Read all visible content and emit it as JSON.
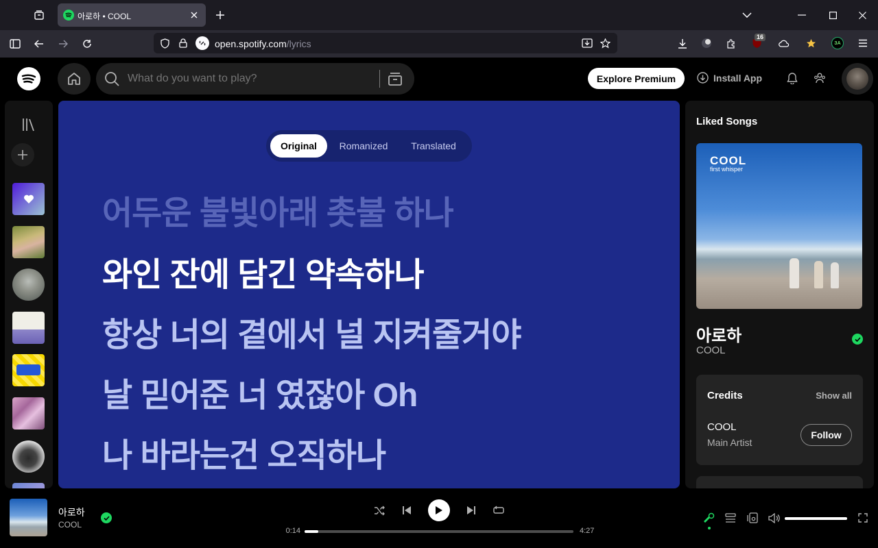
{
  "browser": {
    "tab_title": "아로하 • COOL",
    "url_host": "open.spotify.com",
    "url_path": "/lyrics",
    "extension_badge": "16",
    "extension_label": "ЗА"
  },
  "topbar": {
    "search_placeholder": "What do you want to play?",
    "premium_label": "Explore Premium",
    "install_label": "Install App"
  },
  "lyrics": {
    "tabs": [
      "Original",
      "Romanized",
      "Translated"
    ],
    "active_tab": "Original",
    "lines": [
      "어두운 불빛아래 촛불 하나",
      "와인 잔에 담긴 약속하나",
      "항상 너의 곁에서 널 지켜줄거야",
      "날 믿어준 너 였잖아 Oh",
      "나 바라는건 오직하나"
    ],
    "current_line": 1,
    "background_color": "#1d2a8a"
  },
  "right_panel": {
    "title": "Liked Songs",
    "album_brand": "COOL",
    "album_subtitle": "first whisper",
    "song_title": "아로하",
    "artist": "COOL",
    "credits_title": "Credits",
    "show_all": "Show all",
    "credit_name": "COOL",
    "credit_role": "Main Artist",
    "follow_label": "Follow"
  },
  "player": {
    "track_title": "아로하",
    "track_artist": "COOL",
    "elapsed": "0:14",
    "duration": "4:27",
    "progress_fraction": 0.052,
    "volume_fraction": 1.0,
    "accent_color": "#1ed760"
  }
}
